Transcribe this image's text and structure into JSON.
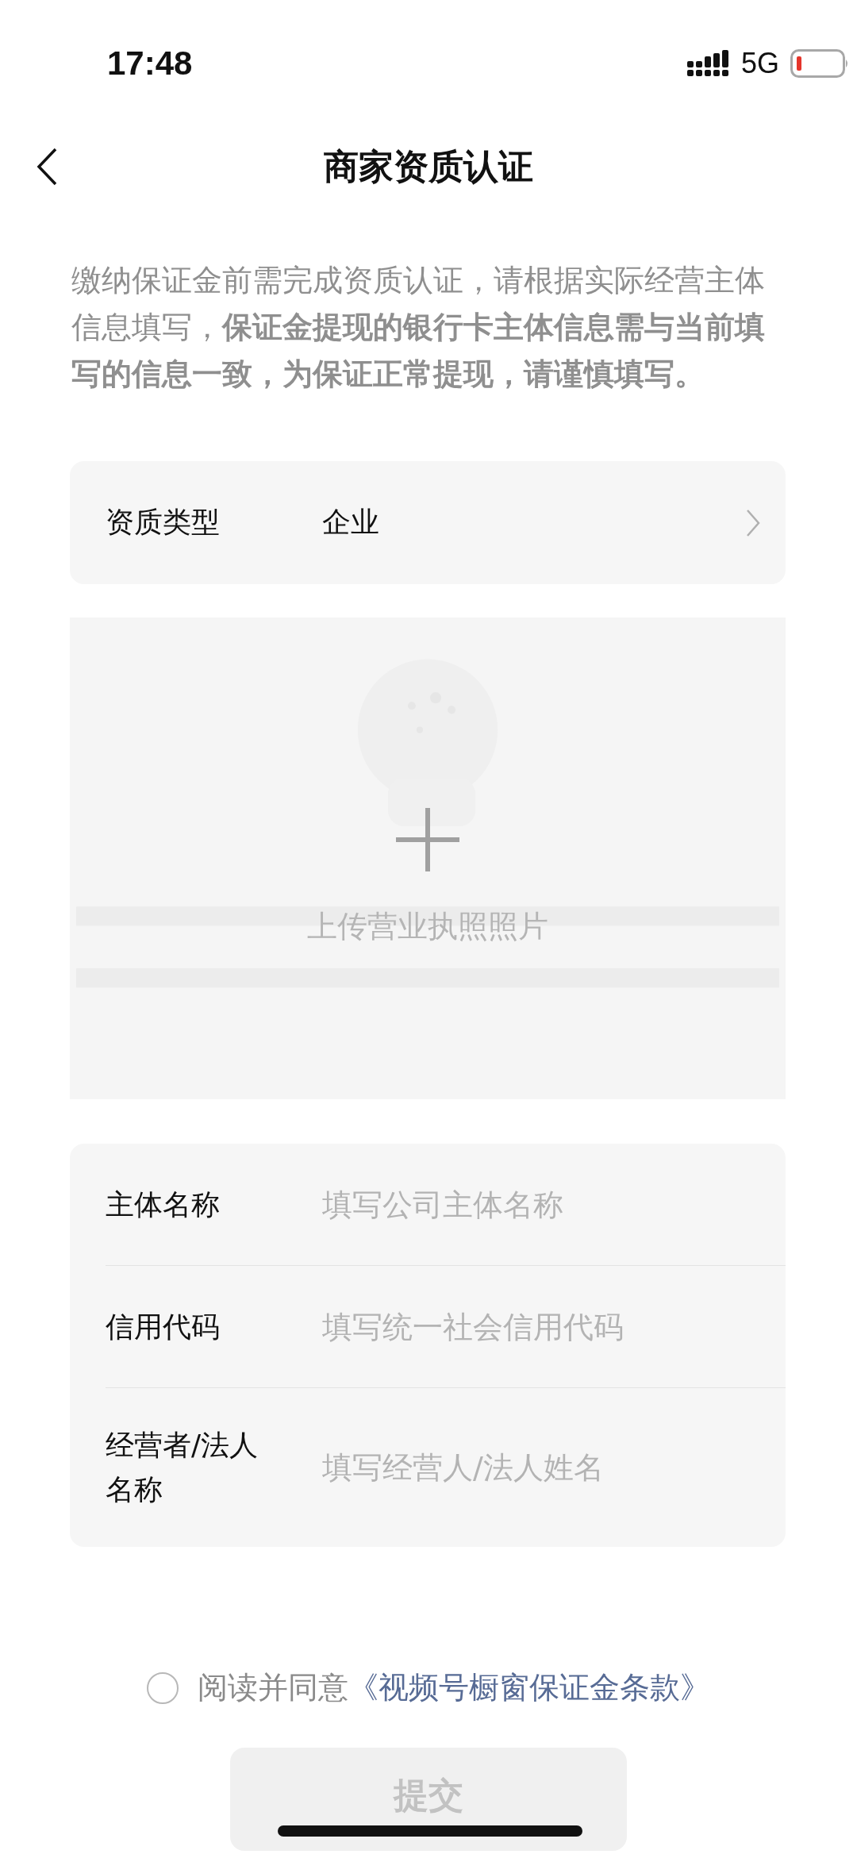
{
  "status_bar": {
    "time": "17:48",
    "network": "5G"
  },
  "nav": {
    "title": "商家资质认证"
  },
  "intro": "缴纳保证金前需完成资质认证，请根据实际经营主体信息填写，**保证金提现的银行卡主体信息需与当前填写的信息一致，为保证正常提现，请谨慎填写。**",
  "qualification": {
    "label": "资质类型",
    "value": "企业"
  },
  "upload": {
    "label": "上传营业执照照片",
    "kind": "picture"
  },
  "fields": [
    {
      "label": "主体名称",
      "placeholder": "填写公司主体名称"
    },
    {
      "label": "信用代码",
      "placeholder": "填写统一社会信用代码"
    },
    {
      "label": "经营者/法人名称",
      "placeholder": "填写经营人/法人姓名"
    }
  ],
  "agreement": {
    "checked": false,
    "text": "阅读并同意",
    "link": "《视频号橱窗保证金条款》"
  },
  "submit": {
    "label": "提交"
  }
}
